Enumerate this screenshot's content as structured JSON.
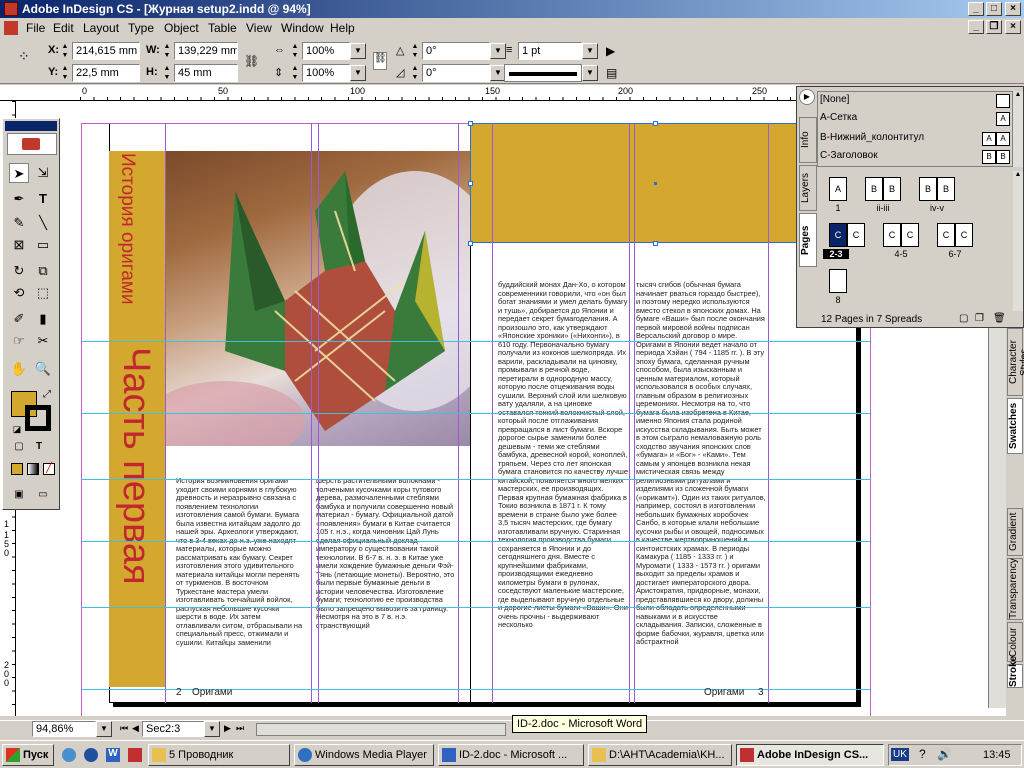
{
  "window": {
    "title": "Adobe InDesign CS - [Журная setup2.indd @ 94%]"
  },
  "menu": [
    "File",
    "Edit",
    "Layout",
    "Type",
    "Object",
    "Table",
    "View",
    "Window",
    "Help"
  ],
  "control": {
    "x_label": "X:",
    "x_value": "214,615 mm",
    "y_label": "Y:",
    "y_value": "22,5 mm",
    "w_label": "W:",
    "w_value": "139,229 mm",
    "h_label": "H:",
    "h_value": "45 mm",
    "scale_x": "100%",
    "scale_y": "100%",
    "rotate": "0°",
    "shear": "0°",
    "stroke_weight": "1 pt"
  },
  "ruler": {
    "h_labels": [
      "0",
      "50",
      "100",
      "150",
      "200",
      "250"
    ],
    "v_labels": [
      "1",
      "1 5 0",
      "2 0 0"
    ]
  },
  "colors": {
    "title_start": "#0a246a",
    "title_end": "#a6caf0",
    "gold": "#d4a72e",
    "red_text": "#c0282d",
    "frame_blue": "#2a6fd6",
    "guide_cyan": "#40c0e0",
    "guide_purple": "#9b59d6",
    "selected_spread": "#0a246a"
  },
  "document": {
    "vertical_title_small": "История оригами",
    "vertical_title_large": "Часть первая",
    "footer_left_num": "2",
    "footer_left": "Оригами",
    "footer_right": "Оригами",
    "footer_right_num": "3",
    "columns": [
      "История возникновения оригами уходит своими корнями в глубокую древность и неразрывно связана с появлением технологии изготовления самой бумаги. Бумага была известна китайцам задолго до нашей эры. Археологи утверждают, что в 3-4 веках до н.э. уже находят материалы, которые можно рассматривать как бумагу. Секрет изготовления этого удивительного материала китайцы могли перенять от туркменов. В восточном Туркестане мастера умели изготавливать тончайший войлок, распуская небольшие кусочки шерсти в воде. Их затем отлавливали ситом, отбрасывали на специальный пресс, отжимали и сушили. Китайцы заменили",
      "шерсть растительными волокнами - толчеными кусочками коры тутового дерева, размочаленными стеблями бамбука и получили совершенно новый материал - бумагу. Официальной датой «появления» бумаги в Китае считается 105 г. н.э., когда чиновник Цай Лунь сделал официальный доклад императору о существовании такой технологии. В 6-7 в. н. э. в Китае уже имели хождение бумажные деньги Фэй-Тянь (летающие монеты). Вероятно, это были первые бумажные деньги в истории человечества. Изготовление бумаги; технологию ее производства было запрещено вывозить за границу. Несмотря на это в 7 в. н.э. странствующий",
      "буддийский монах Дан-Хо, о котором современники говорили, что «он был богат знаниями и умел делать бумагу и тушь», добирается до Японии и передает секрет бумагоделания. А произошло это, как утверждают «Японские хроники» («Нихонги»), в 610 году. Первоначально бумагу получали из коконов шелкопряда. Их варили, раскладывали на циновку, промывали в речной воде, перетирали в однородную массу, которую после отцеживания воды сушили. Верхний слой или шелковую вату удаляли, а на циновке оставался тонкий волокнистый слой, который после отглаживания превращался в лист бумаги. Вскоре дорогое сырье заменили более дешевым - теми же стеблями бамбука, древесной корой, коноплей, тряпьем. Через сто лет японская бумага становится по качеству лучше китайской, появляется много мелких мастерских, ее производящих. Первая крупная бумажная фабрика в Токио возникла в 1871 г. К тому времени в стране было уже более 3,5 тысяч мастерских, где бумагу изготавливали вручную. Старинная технология производства бумаги сохраняется в Японии и до сегодняшнего дня. Вместе с крупнейшими фабриками, производящими ежедневно километры бумаги в рулонах, соседствуют маленькие мастерские, где выделывают вручную отдельные и дорогие листы бумаги «Ваши». Они очень прочны - выдерживают несколько",
      "тысяч сгибов (обычная бумага начинает рваться гораздо быстрее), и поэтому нередко используются вместо стекол в японских домах. На бумаге «Ваши» был после окончания первой мировой войны подписан Версальский договор о мире. Оригами в Японии ведет начало от периода Хэйан ( 794 - 1185 гг. ). В эту эпоху бумага, сделанная ручным способом, была изысканным и ценным материалом, который использовался в особых случаях, главным образом в религиозных церемониях. Несмотря на то, что бумага была изобретена в Китае, именно Япония стала родиной искусства складывания. Быть может в этом сыграло немаловажную роль сходство звучания японских слов «бумага» и «Бог» - «Ками». Тем самым у японцев возникла некая мистическая связь между религиозными ритуалами и изделиями из сложенной бумаги («орикамт»). Один из таких ритуалов, например, состоял в изготовлении небольших бумажных коробочек Санбо, в которые клали небольшие кусочки рыбы и овощей, подносимых в качестве жертвоприношений в синтоистских храмах. В периоды Камакура ( 1185 - 1333 гг. ) и Муромати ( 1333 - 1573 гг. ) оригами выходит за пределы храмов и достигает императорского двора. Аристократия, придворные, монахи, представлявшиеся ко двору, должны были обладать определенными навыками и в искусстве складывания. Записки, сложенные в форме бабочки, журавля, цветка или абстрактной"
    ]
  },
  "pages_panel": {
    "tabs": [
      "Info",
      "Layers",
      "Pages"
    ],
    "masters": [
      {
        "name": "[None]",
        "pages": [
          ""
        ]
      },
      {
        "name": "A-Сетка",
        "pages": [
          "A"
        ]
      },
      {
        "name": "B-Нижний_колонтитул",
        "pages": [
          "A",
          "A"
        ]
      },
      {
        "name": "C-Заголовок",
        "pages": [
          "B",
          "B"
        ]
      }
    ],
    "spreads": [
      {
        "label": "1",
        "pages": [
          "A"
        ]
      },
      {
        "label": "ii-iii",
        "pages": [
          "B",
          "B"
        ]
      },
      {
        "label": "iv-v",
        "pages": [
          "B",
          "B"
        ]
      },
      {
        "label": "2-3",
        "pages": [
          "C",
          "C"
        ]
      },
      {
        "label": "4-5",
        "pages": [
          "C",
          "C"
        ]
      },
      {
        "label": "6-7",
        "pages": [
          "C",
          "C"
        ]
      },
      {
        "label": "8",
        "pages": [
          ""
        ]
      }
    ],
    "footer": "12 Pages in 7 Spreads"
  },
  "right_tabs": [
    "Character Styles",
    "Swatches",
    "Gradient",
    "Transparency",
    "Colour",
    "Stroke"
  ],
  "status": {
    "zoom": "94,86%",
    "page": "Sec2:3",
    "tooltip": "ID-2.doc - Microsoft Word"
  },
  "taskbar": {
    "start": "Пуск",
    "items": [
      "5 Проводник",
      "Windows Media Player",
      "ID-2.doc - Microsoft ...",
      "D:\\AHT\\Academia\\KH...",
      "Adobe InDesign CS..."
    ],
    "lang": "UK",
    "time": "13:45"
  }
}
